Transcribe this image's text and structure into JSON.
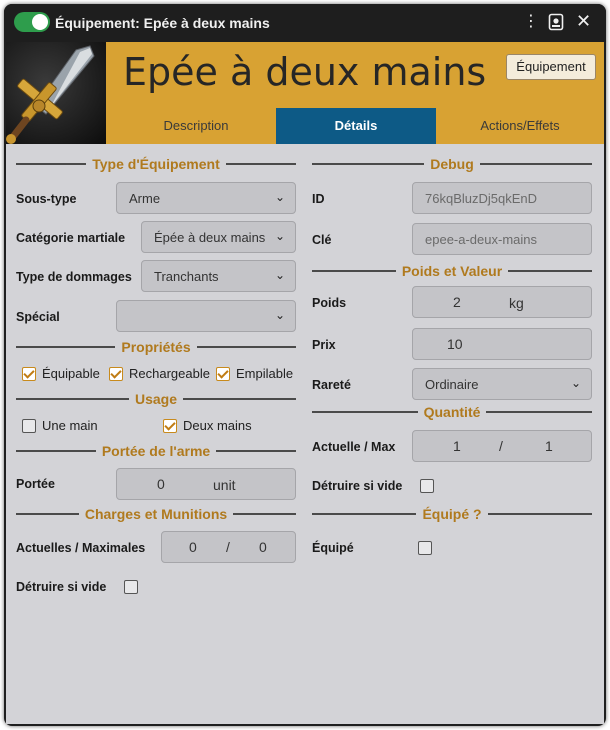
{
  "window": {
    "title": "Équipement: Epée à deux mains"
  },
  "header": {
    "item_name": "Epée à deux mains",
    "type_badge": "Équipement",
    "tabs": [
      {
        "label": "Description",
        "active": false
      },
      {
        "label": "Détails",
        "active": true
      },
      {
        "label": "Actions/Effets",
        "active": false
      }
    ]
  },
  "left": {
    "type_section": "Type d'Équipement",
    "subtype": {
      "label": "Sous-type",
      "value": "Arme"
    },
    "martial": {
      "label": "Catégorie martiale",
      "value": "Épée à deux mains"
    },
    "damage": {
      "label": "Type de dommages",
      "value": "Tranchants"
    },
    "special": {
      "label": "Spécial",
      "value": ""
    },
    "props_section": "Propriétés",
    "props": [
      {
        "label": "Équipable",
        "checked": true
      },
      {
        "label": "Rechargeable",
        "checked": true
      },
      {
        "label": "Empilable",
        "checked": true
      }
    ],
    "usage_section": "Usage",
    "usage": [
      {
        "label": "Une main",
        "checked": false
      },
      {
        "label": "Deux mains",
        "checked": true
      }
    ],
    "range_section": "Portée de l'arme",
    "range": {
      "label": "Portée",
      "value": "0",
      "unit": "unit"
    },
    "charges_section": "Charges et Munitions",
    "charges": {
      "label": "Actuelles / Maximales",
      "current": "0",
      "sep": "/",
      "max": "0"
    },
    "destroy": {
      "label": "Détruire si vide",
      "checked": false
    }
  },
  "right": {
    "debug_section": "Debug",
    "id": {
      "label": "ID",
      "value": "76kqBluzDj5qkEnD"
    },
    "key": {
      "label": "Clé",
      "value": "epee-a-deux-mains"
    },
    "weight_section": "Poids et Valeur",
    "weight": {
      "label": "Poids",
      "value": "2",
      "unit": "kg"
    },
    "price": {
      "label": "Prix",
      "value": "10"
    },
    "rarity": {
      "label": "Rareté",
      "value": "Ordinaire"
    },
    "quantity_section": "Quantité",
    "quantity": {
      "label": "Actuelle / Max",
      "current": "1",
      "sep": "/",
      "max": "1"
    },
    "destroy": {
      "label": "Détruire si vide",
      "checked": false
    },
    "equipped_section": "Équipé ?",
    "equipped": {
      "label": "Équipé",
      "checked": false
    }
  },
  "colors": {
    "header_gold": "#d8a233",
    "active_tab": "#0d5a86",
    "section_gold": "#b07a1e",
    "toggle_green": "#2e9d4c"
  },
  "icons": {
    "toggle": "toggle-switch",
    "menu": "kebab-menu-icon",
    "sheet": "sheet-config-icon",
    "close": "close-icon",
    "portrait": "sword-portrait"
  }
}
